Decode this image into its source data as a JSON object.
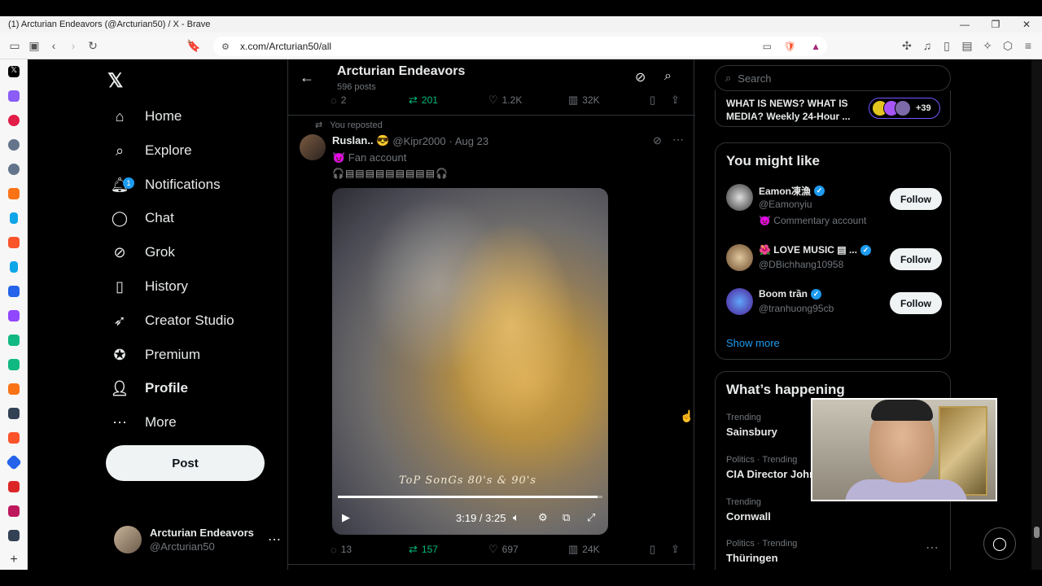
{
  "window": {
    "title": "(1) Arcturian Endeavors (@Arcturian50) / X - Brave",
    "min": "—",
    "max": "❐",
    "close": "✕"
  },
  "browser": {
    "url": "x.com/Arcturian50/all"
  },
  "nav": {
    "items": [
      {
        "label": "Home",
        "icon": "home-icon"
      },
      {
        "label": "Explore",
        "icon": "search-icon"
      },
      {
        "label": "Notifications",
        "icon": "bell-icon",
        "badge": "1"
      },
      {
        "label": "Chat",
        "icon": "chat-icon"
      },
      {
        "label": "Grok",
        "icon": "grok-icon"
      },
      {
        "label": "History",
        "icon": "bookmark-icon"
      },
      {
        "label": "Creator Studio",
        "icon": "rocket-icon"
      },
      {
        "label": "Premium",
        "icon": "verified-icon"
      },
      {
        "label": "Profile",
        "icon": "person-icon"
      },
      {
        "label": "More",
        "icon": "more-icon"
      }
    ],
    "post_label": "Post",
    "account": {
      "name": "Arcturian Endeavors",
      "handle": "@Arcturian50"
    }
  },
  "header": {
    "title": "Arcturian Endeavors",
    "subtitle": "596 posts"
  },
  "prev_post_actions": {
    "replies": "2",
    "reposts": "201",
    "likes": "1.2K",
    "views": "32K"
  },
  "post": {
    "repost_label": "You reposted",
    "author_name": "Ruslan.. 😎",
    "author_handle": "@Kipr2000",
    "date": "· Aug 23",
    "fan_label": "😈 Fan account",
    "deco_text": "🎧▤▤▤▤▤▤▤▤▤🎧",
    "video": {
      "caption": "ToP SonGs 80's & 90's",
      "time": "3:19 / 3:25",
      "progress": 0.98
    },
    "actions": {
      "replies": "13",
      "reposts": "157",
      "likes": "697",
      "views": "24K"
    }
  },
  "sidebar": {
    "search_placeholder": "Search",
    "news": {
      "text": "WHAT IS NEWS? WHAT IS MEDIA? Weekly 24-Hour ...",
      "count": "+39"
    },
    "might_like_title": "You might like",
    "suggestions": [
      {
        "name": "Eamon凍漁",
        "handle": "@Eamonyiu",
        "extra": "😈 Commentary account",
        "follow": "Follow"
      },
      {
        "name": "🌺 LOVE MUSIC ▤ ...",
        "handle": "@DBichhang10958",
        "extra": "",
        "follow": "Follow"
      },
      {
        "name": "Boom trần",
        "handle": "@tranhuong95cb",
        "extra": "",
        "follow": "Follow"
      }
    ],
    "show_more": "Show more",
    "happening_title": "What’s happening",
    "trends": [
      {
        "context": "Trending",
        "name": "Sainsbury"
      },
      {
        "context": "Politics · Trending",
        "name": "CIA Director John"
      },
      {
        "context": "Trending",
        "name": "Cornwall"
      },
      {
        "context": "Politics · Trending",
        "name": "Thüringen"
      }
    ]
  },
  "colors": {
    "accent": "#1d9bf0",
    "repost_green": "#00ba7c",
    "background": "#000000"
  }
}
